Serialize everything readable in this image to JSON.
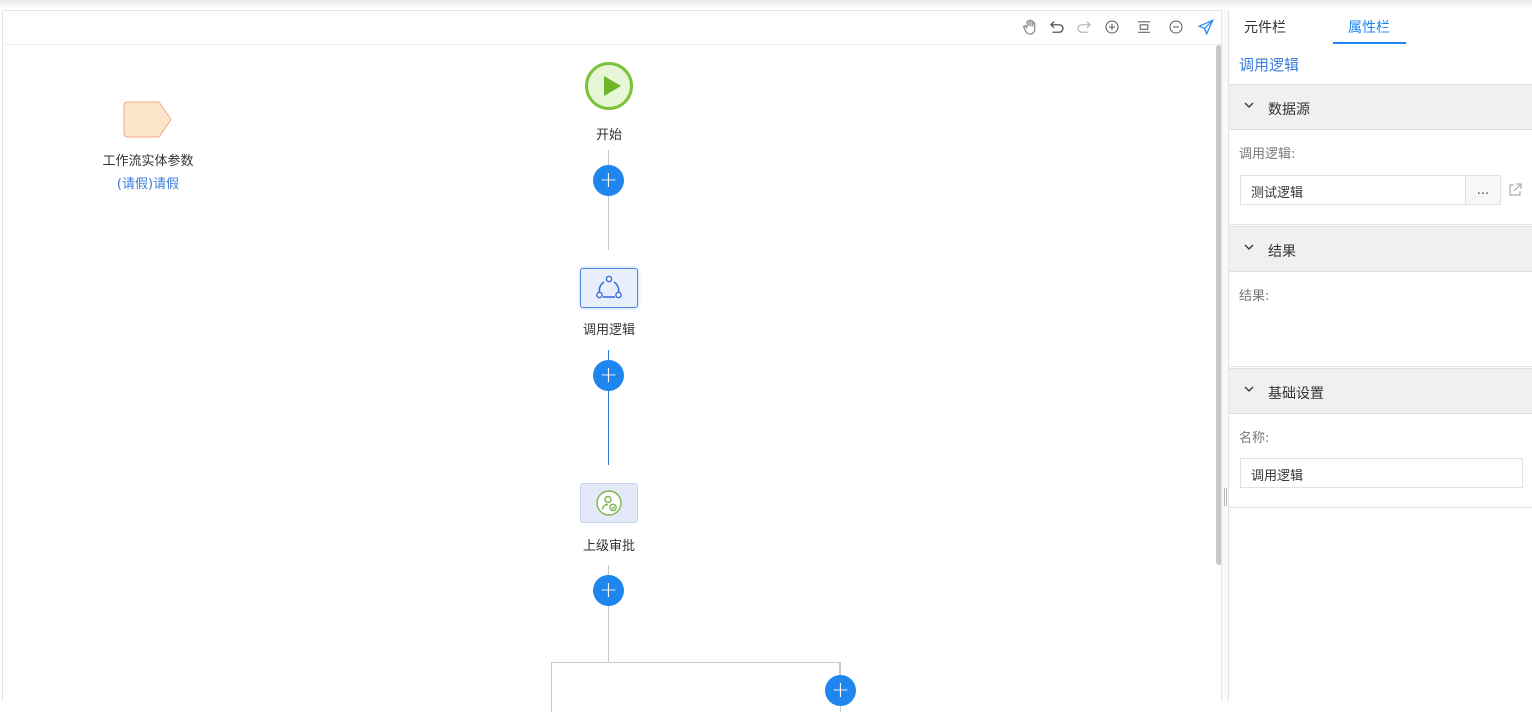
{
  "toolbar": {
    "icons": [
      "hand-icon",
      "undo-icon",
      "redo-icon",
      "zoom-in-icon",
      "fit-icon",
      "zoom-out-icon",
      "send-icon"
    ]
  },
  "entity": {
    "title": "工作流实体参数",
    "subtitle": "(请假)请假"
  },
  "flow": {
    "start_label": "开始",
    "node1_label": "调用逻辑",
    "node2_label": "上级审批",
    "add_symbol": "+"
  },
  "panel": {
    "tabs": [
      {
        "label": "元件栏",
        "active": false
      },
      {
        "label": "属性栏",
        "active": true
      }
    ],
    "title": "调用逻辑",
    "sections": {
      "datasource": {
        "header": "数据源",
        "field_label": "调用逻辑:",
        "field_value": "测试逻辑",
        "dots": "..."
      },
      "result": {
        "header": "结果",
        "field_label": "结果:"
      },
      "basic": {
        "header": "基础设置",
        "field_label": "名称:",
        "field_value": "调用逻辑"
      }
    }
  },
  "colors": {
    "accent": "#1f86f0",
    "start_green": "#7ac23a",
    "link_blue": "#3b7ddd"
  }
}
